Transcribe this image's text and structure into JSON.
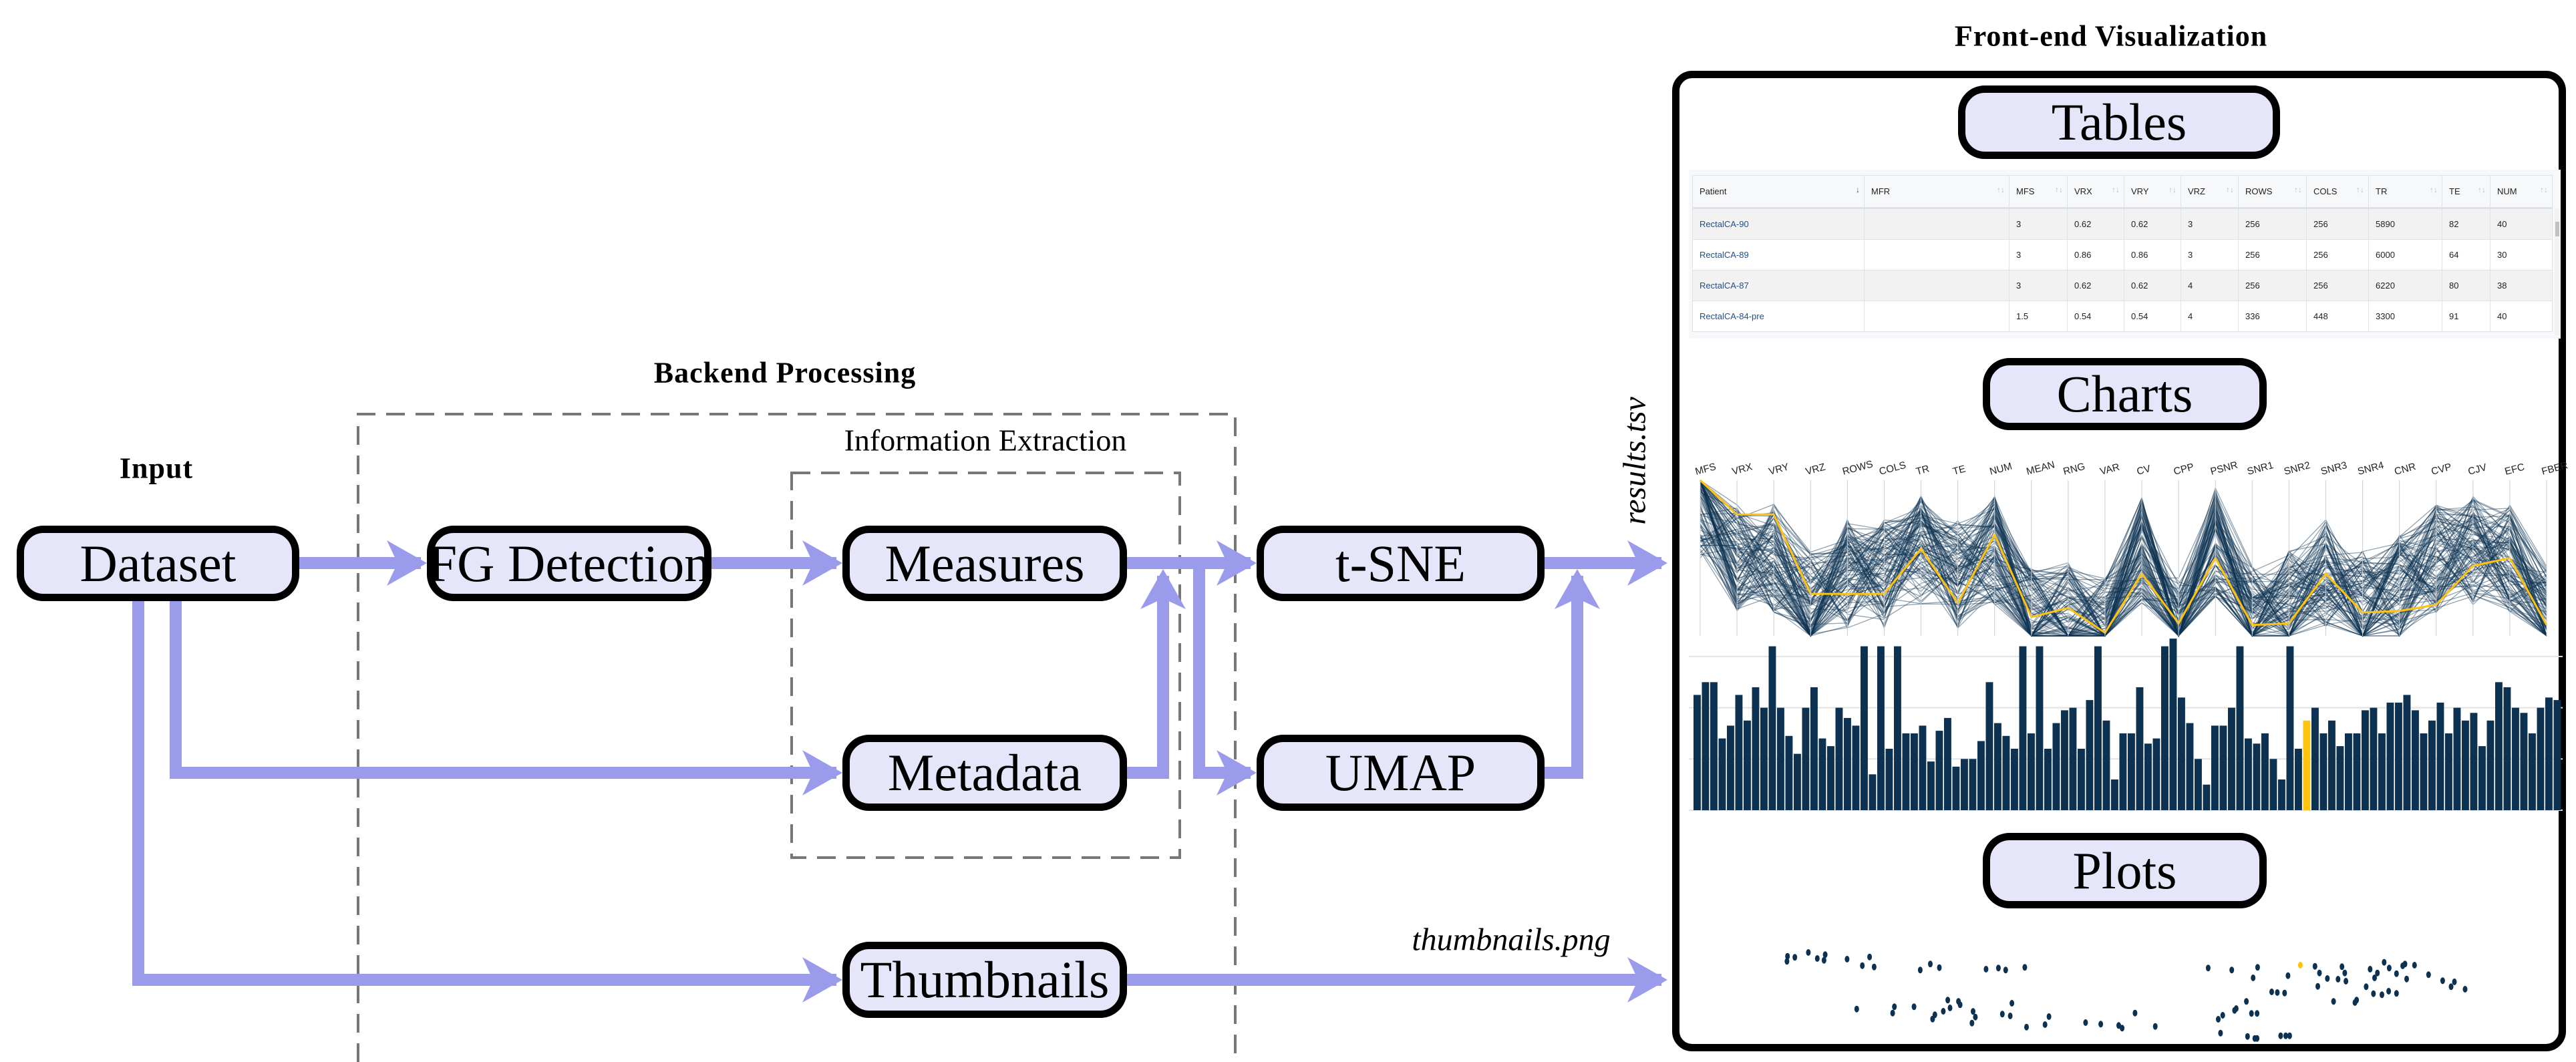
{
  "input": {
    "title": "Input",
    "dataset": "Dataset"
  },
  "backend": {
    "title": "Backend Processing",
    "fg_detection": "FG Detection",
    "info_extraction": {
      "title": "Information Extraction",
      "measures": "Measures",
      "metadata": "Metadata"
    },
    "tsne": "t-SNE",
    "umap": "UMAP",
    "thumbnails": "Thumbnails"
  },
  "outputs": {
    "results_file": "results.tsv",
    "thumbnails_file": "thumbnails.png"
  },
  "frontend": {
    "title": "Front-end Visualization",
    "tables_label": "Tables",
    "charts_label": "Charts",
    "plots_label": "Plots",
    "table": {
      "headers": [
        "Patient",
        "MFR",
        "MFS",
        "VRX",
        "VRY",
        "VRZ",
        "ROWS",
        "COLS",
        "TR",
        "TE",
        "NUM"
      ],
      "rows": [
        [
          "RectalCA-90",
          "",
          "3",
          "0.62",
          "0.62",
          "3",
          "256",
          "256",
          "5890",
          "82",
          "40"
        ],
        [
          "RectalCA-89",
          "",
          "3",
          "0.86",
          "0.86",
          "3",
          "256",
          "256",
          "6000",
          "64",
          "30"
        ],
        [
          "RectalCA-87",
          "",
          "3",
          "0.62",
          "0.62",
          "4",
          "256",
          "256",
          "6220",
          "80",
          "38"
        ],
        [
          "RectalCA-84-pre",
          "",
          "1.5",
          "0.54",
          "0.54",
          "4",
          "336",
          "448",
          "3300",
          "91",
          "40"
        ]
      ]
    },
    "parallel_axes": [
      "MFS",
      "VRX",
      "VRY",
      "VRZ",
      "ROWS",
      "COLS",
      "TR",
      "TE",
      "NUM",
      "MEAN",
      "RNG",
      "VAR",
      "CV",
      "CPP",
      "PSNR",
      "SNR1",
      "SNR2",
      "SNR3",
      "SNR4",
      "CNR",
      "CVP",
      "CJV",
      "EFC",
      "FBER"
    ],
    "colors": {
      "arrow": "#9b9bec",
      "node_fill": "#e6e6fa",
      "series": "#0d3251",
      "highlight": "#ffc20e"
    },
    "bar_values": [
      2.25,
      2.5,
      2.5,
      1.4,
      1.65,
      2.25,
      1.75,
      2.4,
      2.0,
      3.2,
      2.0,
      1.45,
      1.1,
      2.0,
      2.4,
      1.4,
      1.25,
      2.0,
      1.8,
      1.65,
      3.2,
      0.7,
      3.2,
      1.2,
      3.2,
      1.5,
      1.5,
      1.65,
      0.95,
      1.55,
      1.8,
      0.85,
      1.0,
      1.0,
      1.35,
      2.5,
      1.7,
      1.45,
      1.2,
      3.2,
      1.5,
      3.2,
      1.2,
      1.7,
      1.95,
      2.0,
      1.2,
      2.15,
      3.2,
      1.75,
      0.6,
      1.5,
      1.5,
      2.4,
      1.3,
      1.4,
      3.2,
      3.35,
      2.2,
      1.7,
      1.0,
      0.5,
      1.65,
      1.65,
      2.0,
      3.2,
      1.4,
      1.3,
      1.5,
      1.0,
      0.6,
      3.2,
      1.2,
      1.75,
      2.0,
      1.5,
      1.75,
      1.25,
      1.5,
      1.5,
      1.95,
      2.0,
      1.5,
      2.1,
      2.1,
      2.25,
      1.95,
      1.5,
      1.75,
      2.1,
      1.5,
      2.0,
      1.75,
      1.9,
      1.25,
      1.75,
      2.5,
      2.4,
      2.0,
      1.9,
      1.5,
      2.0,
      2.2,
      2.15
    ],
    "bar_highlight_index": 73,
    "scatter_points": [
      [
        18.5,
        39.5
      ],
      [
        19.8,
        39
      ],
      [
        18.4,
        37.2
      ],
      [
        22.2,
        41.2
      ],
      [
        23.8,
        38.5
      ],
      [
        25.2,
        40.2
      ],
      [
        25,
        37.7
      ],
      [
        29.1,
        38.2
      ],
      [
        33.1,
        39.2
      ],
      [
        31.8,
        35.3
      ],
      [
        33.9,
        34.7
      ],
      [
        43.9,
        36
      ],
      [
        45.5,
        34.4
      ],
      [
        42.1,
        33.3
      ],
      [
        53.8,
        33.7
      ],
      [
        56,
        34.2
      ],
      [
        57.3,
        33.3
      ],
      [
        60.7,
        34.5
      ],
      [
        30.8,
        15.8
      ],
      [
        37.5,
        16.8
      ],
      [
        37.2,
        14
      ],
      [
        41,
        16.8
      ],
      [
        47,
        19.8
      ],
      [
        48.9,
        19.2
      ],
      [
        49.2,
        17.7
      ],
      [
        47.4,
        16.3
      ],
      [
        46.2,
        14.8
      ],
      [
        44.7,
        13.2
      ],
      [
        44.3,
        11.3
      ],
      [
        51.5,
        14.7
      ],
      [
        51.9,
        12.2
      ],
      [
        51.3,
        9.5
      ],
      [
        56.7,
        13.5
      ],
      [
        58.1,
        12.7
      ],
      [
        58.4,
        18.4
      ],
      [
        65,
        12.4
      ],
      [
        64.3,
        8.8
      ],
      [
        61,
        7.7
      ],
      [
        71.5,
        9.7
      ],
      [
        74.2,
        9
      ],
      [
        77.4,
        8.4
      ],
      [
        78,
        7.2
      ],
      [
        83.9,
        8
      ],
      [
        80.3,
        14
      ],
      [
        93.3,
        34.2
      ],
      [
        97.5,
        33.3
      ],
      [
        102.1,
        34.5
      ],
      [
        101.3,
        29.8
      ],
      [
        107.5,
        30.8
      ],
      [
        112.3,
        35
      ],
      [
        113.1,
        32
      ],
      [
        114.5,
        29.5
      ],
      [
        116.4,
        29.2
      ],
      [
        117.6,
        32
      ],
      [
        117.8,
        28.3
      ],
      [
        117.1,
        34.8
      ],
      [
        122.1,
        33.7
      ],
      [
        123.4,
        32
      ],
      [
        122.9,
        29.8
      ],
      [
        124.6,
        36.8
      ],
      [
        125.5,
        34.2
      ],
      [
        126.8,
        31.7
      ],
      [
        128.3,
        36
      ],
      [
        127.9,
        35.2
      ],
      [
        130,
        35.5
      ],
      [
        128.6,
        29.3
      ],
      [
        132.5,
        31.2
      ],
      [
        135,
        28.5
      ],
      [
        137.1,
        28
      ],
      [
        136.5,
        25.8
      ],
      [
        139,
        24.7
      ],
      [
        112.8,
        26
      ],
      [
        121.4,
        25.8
      ],
      [
        104.6,
        23.5
      ],
      [
        105.6,
        23.2
      ],
      [
        106.9,
        23
      ],
      [
        122.7,
        22.7
      ],
      [
        124.2,
        22.2
      ],
      [
        125.4,
        23.8
      ],
      [
        126.8,
        22.8
      ],
      [
        100.1,
        19.2
      ],
      [
        115.6,
        19.2
      ],
      [
        119.7,
        19.8
      ],
      [
        119.4,
        18.7
      ],
      [
        98,
        15.2
      ],
      [
        98.3,
        16
      ],
      [
        95.9,
        13
      ],
      [
        95.1,
        11.2
      ],
      [
        101,
        13.8
      ],
      [
        102,
        13.8
      ],
      [
        95.5,
        5
      ],
      [
        100.3,
        3.5
      ],
      [
        101.6,
        2.6
      ],
      [
        102,
        2.6
      ],
      [
        106.2,
        3.8
      ],
      [
        107.1,
        3.8
      ],
      [
        107.8,
        3.8
      ],
      [
        109.7,
        35.5
      ]
    ],
    "scatter_highlight_index": 97
  }
}
